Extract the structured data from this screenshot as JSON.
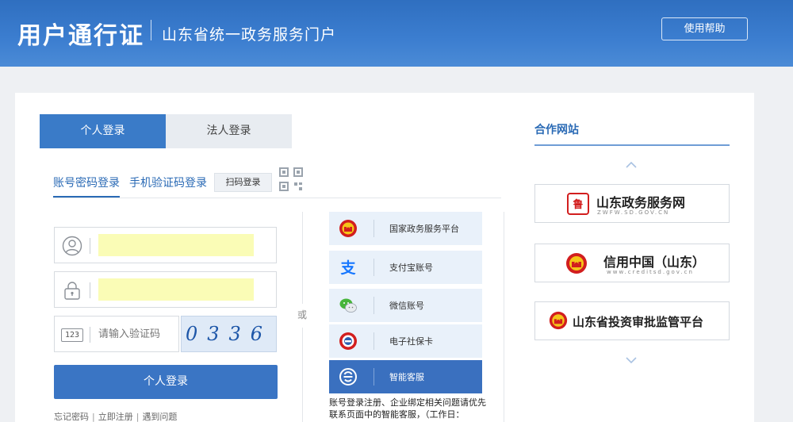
{
  "header": {
    "brand": "用户通行证",
    "subtitle": "山东省统一政务服务门户",
    "help_label": "使用帮助"
  },
  "login": {
    "tabs": [
      {
        "label": "个人登录",
        "active": true
      },
      {
        "label": "法人登录",
        "active": false
      }
    ],
    "methods": [
      {
        "label": "账号密码登录",
        "active": true
      },
      {
        "label": "手机验证码登录",
        "active": false
      }
    ],
    "qr_label": "扫码登录",
    "username_value": "",
    "password_value": "",
    "captcha_placeholder": "请输入验证码",
    "captcha_icon_text": "123",
    "captcha_code": "0336",
    "submit_label": "个人登录",
    "links": [
      "忘记密码",
      "立即注册",
      "遇到问题"
    ]
  },
  "or_text": "或",
  "third_party": [
    {
      "label": "国家政务服务平台",
      "icon": "national-emblem-icon"
    },
    {
      "label": "支付宝账号",
      "icon": "alipay-icon"
    },
    {
      "label": "微信账号",
      "icon": "wechat-icon"
    },
    {
      "label": "电子社保卡",
      "icon": "social-security-icon"
    },
    {
      "label": "智能客服",
      "icon": "chat-bot-icon",
      "highlighted": true
    }
  ],
  "notice": "账号登录注册、企业绑定相关问题请优先联系页面中的智能客服，（工作日：",
  "partners": {
    "title": "合作网站",
    "sites": [
      {
        "name": "山东政务服务网",
        "url": "ZWFW.SD.GOV.CN"
      },
      {
        "name": "信用中国（山东）",
        "url": "www.creditsd.gov.cn"
      },
      {
        "name": "山东省投资审批监管平台",
        "url": ""
      }
    ]
  },
  "colors": {
    "header_blue": "#3c7ed0",
    "primary_blue": "#3a75c4",
    "autofill_yellow": "#fafcb6",
    "emblem_red": "#d21e1e"
  }
}
